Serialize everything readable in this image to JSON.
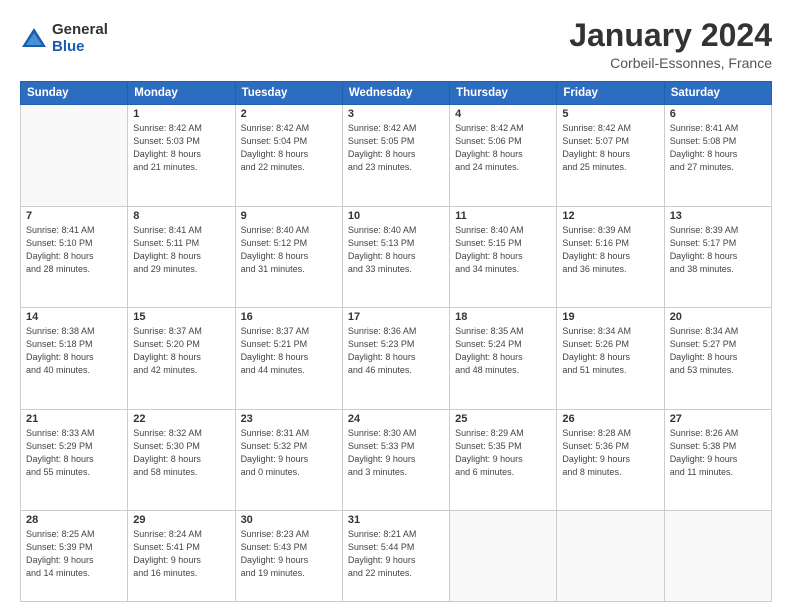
{
  "logo": {
    "general": "General",
    "blue": "Blue"
  },
  "title": "January 2024",
  "subtitle": "Corbeil-Essonnes, France",
  "headers": [
    "Sunday",
    "Monday",
    "Tuesday",
    "Wednesday",
    "Thursday",
    "Friday",
    "Saturday"
  ],
  "weeks": [
    [
      {
        "day": "",
        "info": ""
      },
      {
        "day": "1",
        "info": "Sunrise: 8:42 AM\nSunset: 5:03 PM\nDaylight: 8 hours\nand 21 minutes."
      },
      {
        "day": "2",
        "info": "Sunrise: 8:42 AM\nSunset: 5:04 PM\nDaylight: 8 hours\nand 22 minutes."
      },
      {
        "day": "3",
        "info": "Sunrise: 8:42 AM\nSunset: 5:05 PM\nDaylight: 8 hours\nand 23 minutes."
      },
      {
        "day": "4",
        "info": "Sunrise: 8:42 AM\nSunset: 5:06 PM\nDaylight: 8 hours\nand 24 minutes."
      },
      {
        "day": "5",
        "info": "Sunrise: 8:42 AM\nSunset: 5:07 PM\nDaylight: 8 hours\nand 25 minutes."
      },
      {
        "day": "6",
        "info": "Sunrise: 8:41 AM\nSunset: 5:08 PM\nDaylight: 8 hours\nand 27 minutes."
      }
    ],
    [
      {
        "day": "7",
        "info": "Sunrise: 8:41 AM\nSunset: 5:10 PM\nDaylight: 8 hours\nand 28 minutes."
      },
      {
        "day": "8",
        "info": "Sunrise: 8:41 AM\nSunset: 5:11 PM\nDaylight: 8 hours\nand 29 minutes."
      },
      {
        "day": "9",
        "info": "Sunrise: 8:40 AM\nSunset: 5:12 PM\nDaylight: 8 hours\nand 31 minutes."
      },
      {
        "day": "10",
        "info": "Sunrise: 8:40 AM\nSunset: 5:13 PM\nDaylight: 8 hours\nand 33 minutes."
      },
      {
        "day": "11",
        "info": "Sunrise: 8:40 AM\nSunset: 5:15 PM\nDaylight: 8 hours\nand 34 minutes."
      },
      {
        "day": "12",
        "info": "Sunrise: 8:39 AM\nSunset: 5:16 PM\nDaylight: 8 hours\nand 36 minutes."
      },
      {
        "day": "13",
        "info": "Sunrise: 8:39 AM\nSunset: 5:17 PM\nDaylight: 8 hours\nand 38 minutes."
      }
    ],
    [
      {
        "day": "14",
        "info": "Sunrise: 8:38 AM\nSunset: 5:18 PM\nDaylight: 8 hours\nand 40 minutes."
      },
      {
        "day": "15",
        "info": "Sunrise: 8:37 AM\nSunset: 5:20 PM\nDaylight: 8 hours\nand 42 minutes."
      },
      {
        "day": "16",
        "info": "Sunrise: 8:37 AM\nSunset: 5:21 PM\nDaylight: 8 hours\nand 44 minutes."
      },
      {
        "day": "17",
        "info": "Sunrise: 8:36 AM\nSunset: 5:23 PM\nDaylight: 8 hours\nand 46 minutes."
      },
      {
        "day": "18",
        "info": "Sunrise: 8:35 AM\nSunset: 5:24 PM\nDaylight: 8 hours\nand 48 minutes."
      },
      {
        "day": "19",
        "info": "Sunrise: 8:34 AM\nSunset: 5:26 PM\nDaylight: 8 hours\nand 51 minutes."
      },
      {
        "day": "20",
        "info": "Sunrise: 8:34 AM\nSunset: 5:27 PM\nDaylight: 8 hours\nand 53 minutes."
      }
    ],
    [
      {
        "day": "21",
        "info": "Sunrise: 8:33 AM\nSunset: 5:29 PM\nDaylight: 8 hours\nand 55 minutes."
      },
      {
        "day": "22",
        "info": "Sunrise: 8:32 AM\nSunset: 5:30 PM\nDaylight: 8 hours\nand 58 minutes."
      },
      {
        "day": "23",
        "info": "Sunrise: 8:31 AM\nSunset: 5:32 PM\nDaylight: 9 hours\nand 0 minutes."
      },
      {
        "day": "24",
        "info": "Sunrise: 8:30 AM\nSunset: 5:33 PM\nDaylight: 9 hours\nand 3 minutes."
      },
      {
        "day": "25",
        "info": "Sunrise: 8:29 AM\nSunset: 5:35 PM\nDaylight: 9 hours\nand 6 minutes."
      },
      {
        "day": "26",
        "info": "Sunrise: 8:28 AM\nSunset: 5:36 PM\nDaylight: 9 hours\nand 8 minutes."
      },
      {
        "day": "27",
        "info": "Sunrise: 8:26 AM\nSunset: 5:38 PM\nDaylight: 9 hours\nand 11 minutes."
      }
    ],
    [
      {
        "day": "28",
        "info": "Sunrise: 8:25 AM\nSunset: 5:39 PM\nDaylight: 9 hours\nand 14 minutes."
      },
      {
        "day": "29",
        "info": "Sunrise: 8:24 AM\nSunset: 5:41 PM\nDaylight: 9 hours\nand 16 minutes."
      },
      {
        "day": "30",
        "info": "Sunrise: 8:23 AM\nSunset: 5:43 PM\nDaylight: 9 hours\nand 19 minutes."
      },
      {
        "day": "31",
        "info": "Sunrise: 8:21 AM\nSunset: 5:44 PM\nDaylight: 9 hours\nand 22 minutes."
      },
      {
        "day": "",
        "info": ""
      },
      {
        "day": "",
        "info": ""
      },
      {
        "day": "",
        "info": ""
      }
    ]
  ]
}
